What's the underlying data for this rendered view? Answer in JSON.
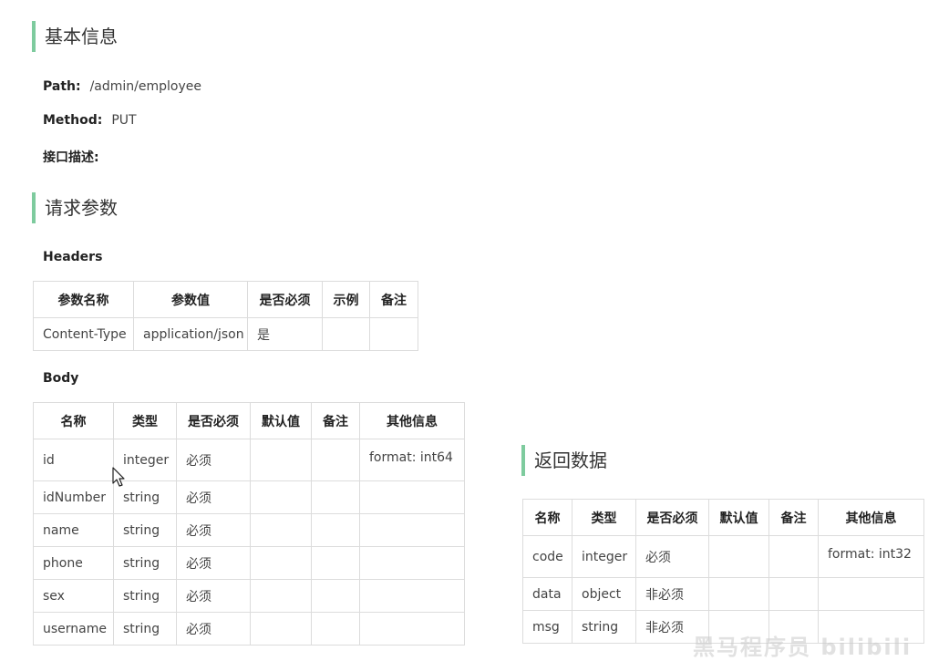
{
  "sections": {
    "basic": "基本信息",
    "request": "请求参数",
    "response": "返回数据"
  },
  "meta": {
    "path_label": "Path:",
    "path_value": "/admin/employee",
    "method_label": "Method:",
    "method_value": "PUT",
    "desc_label": "接口描述:"
  },
  "headers": {
    "title": "Headers",
    "columns": [
      "参数名称",
      "参数值",
      "是否必须",
      "示例",
      "备注"
    ],
    "rows": [
      [
        "Content-Type",
        "application/json",
        "是",
        "",
        ""
      ]
    ]
  },
  "body": {
    "title": "Body",
    "columns": [
      "名称",
      "类型",
      "是否必须",
      "默认值",
      "备注",
      "其他信息"
    ],
    "rows": [
      [
        "id",
        "integer",
        "必须",
        "",
        "",
        "format: int64"
      ],
      [
        "idNumber",
        "string",
        "必须",
        "",
        "",
        ""
      ],
      [
        "name",
        "string",
        "必须",
        "",
        "",
        ""
      ],
      [
        "phone",
        "string",
        "必须",
        "",
        "",
        ""
      ],
      [
        "sex",
        "string",
        "必须",
        "",
        "",
        ""
      ],
      [
        "username",
        "string",
        "必须",
        "",
        "",
        ""
      ]
    ]
  },
  "response": {
    "columns": [
      "名称",
      "类型",
      "是否必须",
      "默认值",
      "备注",
      "其他信息"
    ],
    "rows": [
      [
        "code",
        "integer",
        "必须",
        "",
        "",
        "format: int32"
      ],
      [
        "data",
        "object",
        "非必须",
        "",
        "",
        ""
      ],
      [
        "msg",
        "string",
        "非必须",
        "",
        "",
        ""
      ]
    ]
  },
  "colors": {
    "accent": "#7ecb9e",
    "border": "#dcdcdc"
  },
  "watermark": "黑马程序员 bilibili"
}
